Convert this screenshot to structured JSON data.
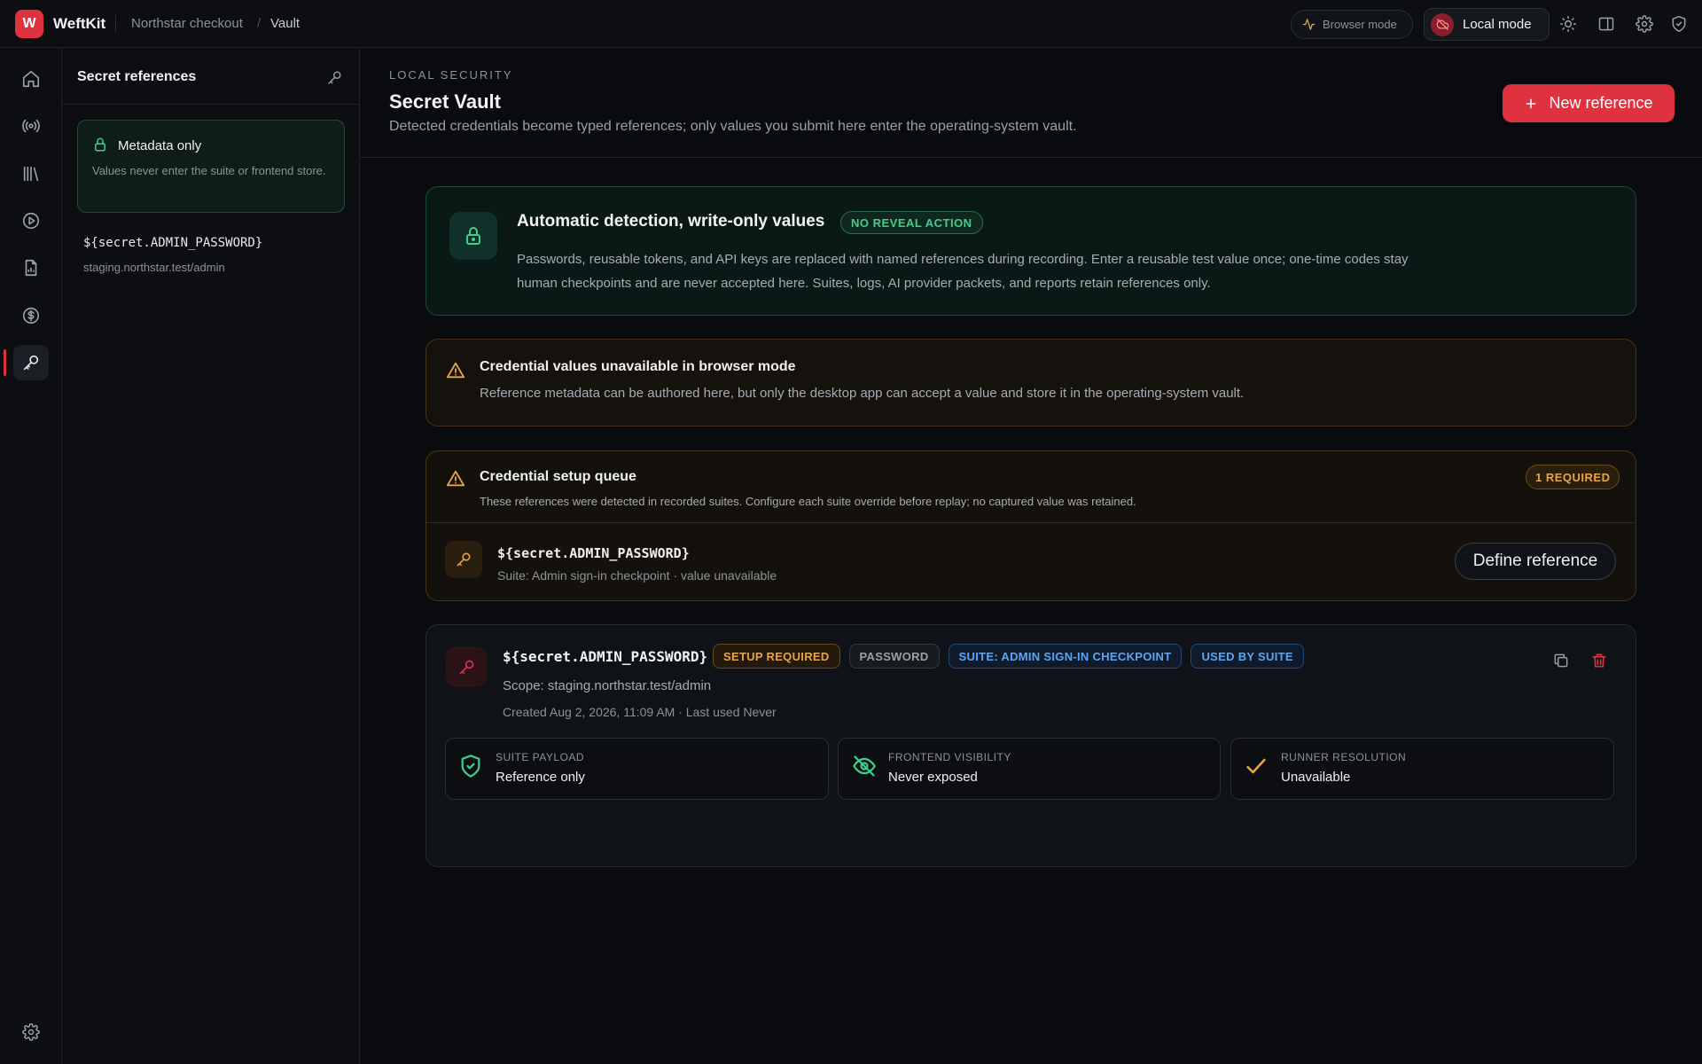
{
  "app": {
    "logo_letter": "W",
    "name": "WeftKit",
    "breadcrumb": [
      "Northstar checkout",
      "Vault"
    ],
    "breadcrumb_sep": "/",
    "browser_mode_label": "Browser mode",
    "local_mode_label": "Local mode"
  },
  "colors": {
    "brand": "#e0313f",
    "success": "#3ecf8e",
    "warning": "#e7a44a",
    "info": "#5ea5f2"
  },
  "rail": {
    "items": [
      {
        "icon": "home-icon"
      },
      {
        "icon": "broadcast-icon"
      },
      {
        "icon": "library-icon"
      },
      {
        "icon": "play-icon"
      },
      {
        "icon": "report-icon"
      },
      {
        "icon": "dollar-icon"
      },
      {
        "icon": "key-icon",
        "active": true
      }
    ],
    "bottom_icon": "settings-icon"
  },
  "sidebar": {
    "title": "Secret references",
    "meta_card": {
      "title": "Metadata only",
      "description": "Values never enter the suite or frontend store."
    },
    "references": [
      {
        "name": "${secret.ADMIN_PASSWORD}",
        "host": "staging.northstar.test/admin"
      }
    ]
  },
  "header": {
    "eyebrow": "LOCAL SECURITY",
    "title": "Secret Vault",
    "subtitle": "Detected credentials become typed references; only values you submit here enter the operating-system vault.",
    "new_button": "New reference"
  },
  "auto_card": {
    "title": "Automatic detection, write-only values",
    "badge": "NO REVEAL ACTION",
    "description": "Passwords, reusable tokens, and API keys are replaced with named references during recording. Enter a reusable test value once; one-time codes stay human checkpoints and are never accepted here. Suites, logs, AI provider packets, and reports retain references only."
  },
  "warning_card": {
    "title": "Credential values unavailable in browser mode",
    "description": "Reference metadata can be authored here, but only the desktop app can accept a value and store it in the operating-system vault."
  },
  "queue": {
    "title": "Credential setup queue",
    "description": "These references were detected in recorded suites. Configure each suite override before replay; no captured value was retained.",
    "badge": "1 REQUIRED",
    "item": {
      "name": "${secret.ADMIN_PASSWORD}",
      "meta": "Suite: Admin sign-in checkpoint · value unavailable",
      "action": "Define reference"
    }
  },
  "reference": {
    "name": "${secret.ADMIN_PASSWORD}",
    "badges": [
      "SETUP REQUIRED",
      "PASSWORD",
      "SUITE: ADMIN SIGN-IN CHECKPOINT",
      "USED BY SUITE"
    ],
    "scope": "Scope: staging.northstar.test/admin",
    "created": "Created Aug 2, 2026, 11:09 AM · Last used Never",
    "tiles": [
      {
        "label": "SUITE PAYLOAD",
        "value": "Reference only",
        "icon": "shield-check-icon"
      },
      {
        "label": "FRONTEND VISIBILITY",
        "value": "Never exposed",
        "icon": "eye-off-icon"
      },
      {
        "label": "RUNNER RESOLUTION",
        "value": "Unavailable",
        "icon": "check-icon"
      }
    ]
  }
}
